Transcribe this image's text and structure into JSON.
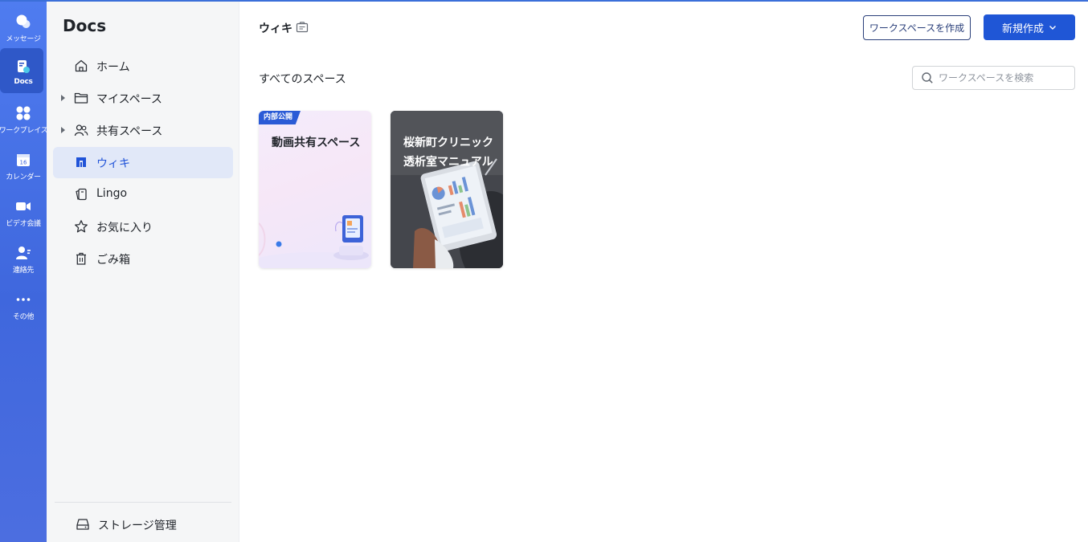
{
  "rail": {
    "items": [
      {
        "label": "メッセージ",
        "icon": "chat-bubble-icon"
      },
      {
        "label": "Docs",
        "icon": "docs-icon",
        "active": true
      },
      {
        "label": "ワークプレイス",
        "icon": "workplace-grid-icon"
      },
      {
        "label": "カレンダー",
        "icon": "calendar-icon",
        "day": "16"
      },
      {
        "label": "ビデオ会議",
        "icon": "video-camera-icon"
      },
      {
        "label": "連絡先",
        "icon": "contacts-icon"
      },
      {
        "label": "その他",
        "icon": "more-dots-icon"
      }
    ]
  },
  "sidebar": {
    "title": "Docs",
    "items": [
      {
        "label": "ホーム",
        "icon": "home-icon"
      },
      {
        "label": "マイスペース",
        "icon": "folder-icon",
        "expandable": true
      },
      {
        "label": "共有スペース",
        "icon": "shared-users-icon",
        "expandable": true
      },
      {
        "label": "ウィキ",
        "icon": "wiki-icon",
        "active": true
      },
      {
        "label": "Lingo",
        "icon": "lingo-icon"
      },
      {
        "label": "お気に入り",
        "icon": "star-icon"
      },
      {
        "label": "ごみ箱",
        "icon": "trash-icon"
      }
    ],
    "storage_label": "ストレージ管理"
  },
  "main": {
    "title": "ウィキ",
    "create_workspace_label": "ワークスペースを作成",
    "new_label": "新規作成",
    "section_title": "すべてのスペース",
    "search_placeholder": "ワークスペースを検索",
    "cards": [
      {
        "badge": "内部公開",
        "title": "動画共有スペース"
      },
      {
        "title": "桜新町クリニック透析室マニュアル"
      }
    ]
  },
  "colors": {
    "rail_bg": "#4a74e8",
    "accent": "#1f56d6",
    "sidebar_bg": "#f5f6f7",
    "active_item_bg": "#e1e8f8"
  }
}
